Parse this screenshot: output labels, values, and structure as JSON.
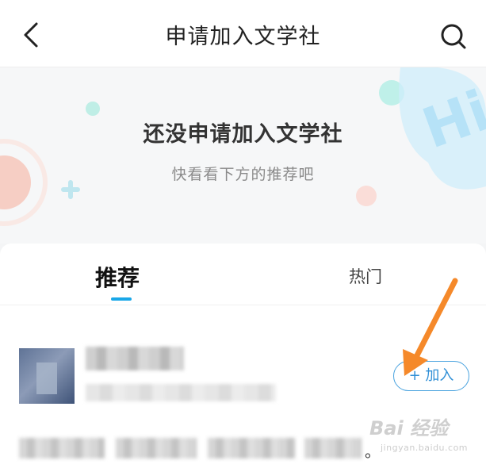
{
  "header": {
    "title": "申请加入文学社",
    "back_icon": "back-arrow-icon",
    "search_icon": "search-icon"
  },
  "banner": {
    "title": "还没申请加入文学社",
    "subtitle": "快看看下方的推荐吧"
  },
  "tabs": [
    {
      "label": "推荐",
      "active": true
    },
    {
      "label": "热门",
      "active": false
    }
  ],
  "club": {
    "join_label": "+ 加入"
  },
  "trailing_text": "。",
  "watermark": {
    "logo": "Bai 经验",
    "url": "jingyan.baidu.com"
  },
  "colors": {
    "accent": "#19a7e8",
    "join": "#2f8fd6",
    "arrow": "#f5892a"
  }
}
